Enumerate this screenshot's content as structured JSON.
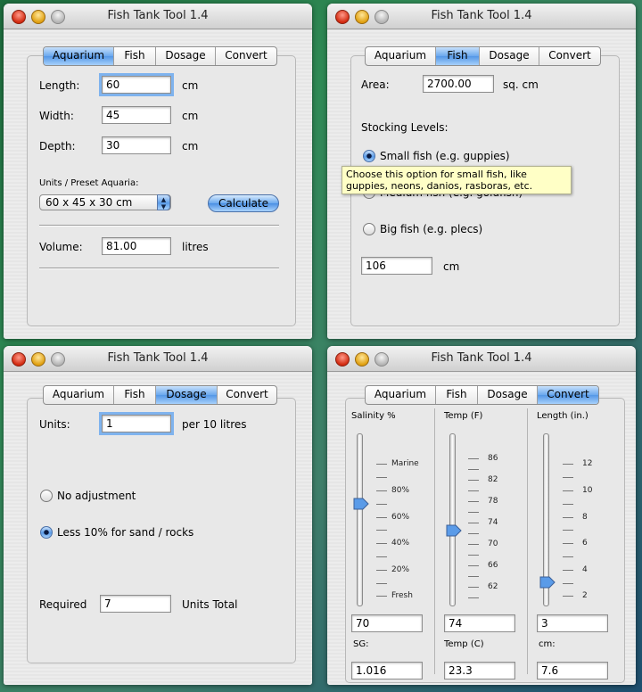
{
  "app_title": "Fish Tank Tool 1.4",
  "tabs": [
    "Aquarium",
    "Fish",
    "Dosage",
    "Convert"
  ],
  "aquarium": {
    "length_label": "Length:",
    "length_value": "60",
    "length_unit": "cm",
    "width_label": "Width:",
    "width_value": "45",
    "width_unit": "cm",
    "depth_label": "Depth:",
    "depth_value": "30",
    "depth_unit": "cm",
    "units_label": "Units / Preset Aquaria:",
    "preset_value": "60 x 45 x 30 cm",
    "calculate_label": "Calculate",
    "volume_label": "Volume:",
    "volume_value": "81.00",
    "volume_unit": "litres"
  },
  "fish": {
    "area_label": "Area:",
    "area_value": "2700.00",
    "area_unit": "sq. cm",
    "stocking_label": "Stocking Levels:",
    "small_label": "Small fish (e.g. guppies)",
    "medium_label": "Medium fish (e.g. goldfish)",
    "big_label": "Big fish (e.g. plecs)",
    "result_value": "106",
    "result_unit": "cm",
    "tooltip": "Choose this option for small fish, like guppies, neons, danios, rasboras, etc."
  },
  "dosage": {
    "units_label": "Units:",
    "units_value": "1",
    "per_label": "per 10 litres",
    "no_adjust_label": "No adjustment",
    "less_label": "Less 10% for sand / rocks",
    "required_label": "Required",
    "required_value": "7",
    "total_label": "Units Total"
  },
  "convert": {
    "salinity_label": "Salinity %",
    "salinity_ticks": [
      "Marine",
      "80%",
      "60%",
      "40%",
      "20%",
      "Fresh"
    ],
    "salinity_value": "70",
    "sg_label": "SG:",
    "sg_value": "1.016",
    "temp_f_label": "Temp (F)",
    "temp_f_ticks": [
      "86",
      "82",
      "78",
      "74",
      "70",
      "66",
      "62"
    ],
    "temp_f_value": "74",
    "temp_c_label": "Temp (C)",
    "temp_c_value": "23.3",
    "length_label": "Length (in.)",
    "length_ticks": [
      "12",
      "10",
      "8",
      "6",
      "4",
      "2"
    ],
    "length_value": "3",
    "cm_label": "cm:",
    "cm_value": "7.6"
  },
  "colors": {
    "selected_tab": "#6aa8ee",
    "tooltip_bg": "#ffffc6",
    "desktop_green": "#2f8a55"
  }
}
